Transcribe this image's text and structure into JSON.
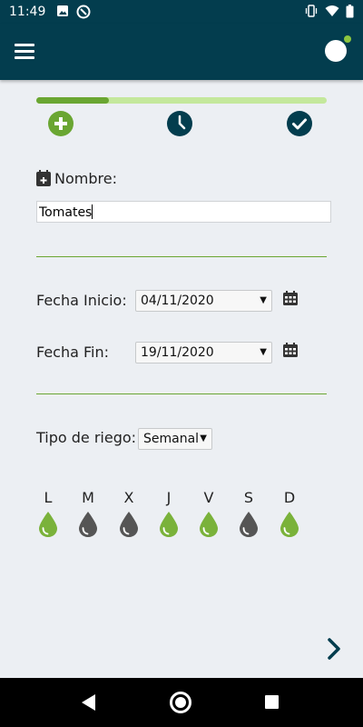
{
  "status_bar": {
    "time": "11:49",
    "icons": [
      "photo-icon",
      "do-not-disturb-icon",
      "vibrate-icon",
      "wifi-icon",
      "battery-icon"
    ]
  },
  "app_bar": {
    "menu_icon": "hamburger-menu-icon",
    "profile_icon": "avatar",
    "notification_dot_color": "#8dc63f"
  },
  "progress": {
    "value": 0.25,
    "fill_color": "#6aa632",
    "track_color": "#c4e89c"
  },
  "steps": [
    {
      "name": "add",
      "icon": "add-circle-icon",
      "color": "#6aa632"
    },
    {
      "name": "schedule",
      "icon": "clock-icon",
      "color": "#033d4e"
    },
    {
      "name": "confirm",
      "icon": "check-circle-icon",
      "color": "#033d4e"
    }
  ],
  "form": {
    "name_label": "Nombre:",
    "name_value": "Tomates",
    "start_date_label": "Fecha Inicio:",
    "start_date_value": "04/11/2020",
    "end_date_label": "Fecha Fin:",
    "end_date_value": "19/11/2020",
    "irrigation_type_label": "Tipo de riego:",
    "irrigation_type_value": "Semanal"
  },
  "days": [
    {
      "letter": "L",
      "active": true
    },
    {
      "letter": "M",
      "active": false
    },
    {
      "letter": "X",
      "active": false
    },
    {
      "letter": "J",
      "active": true
    },
    {
      "letter": "V",
      "active": true
    },
    {
      "letter": "S",
      "active": false
    },
    {
      "letter": "D",
      "active": true
    }
  ],
  "colors": {
    "primary": "#033d4e",
    "accent": "#6aa632",
    "drop_active": "#7ab23a",
    "drop_inactive": "#555555"
  },
  "nav": {
    "icons": [
      "back-icon",
      "home-icon",
      "recents-icon"
    ]
  }
}
